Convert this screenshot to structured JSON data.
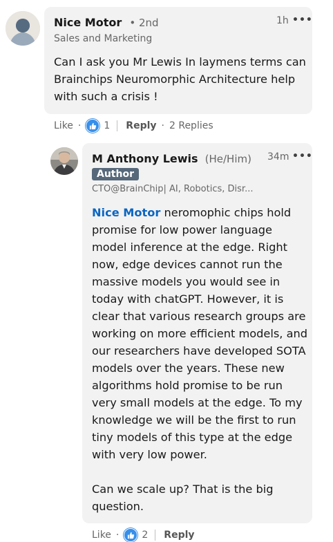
{
  "comment": {
    "author_name": "Nice Motor",
    "degree": "• 2nd",
    "headline": "Sales and Marketing",
    "time": "1h",
    "more": "•••",
    "text": "Can I ask you Mr Lewis In laymens terms can\nBrainchips Neuromorphic Architecture help\nwith such a crisis !",
    "actions": {
      "like": "Like",
      "like_count": "1",
      "reply": "Reply",
      "replies": "2 Replies"
    }
  },
  "reply": {
    "author_name": "M Anthony Lewis",
    "pronouns": "(He/Him)",
    "badge": "Author",
    "headline": "CTO@BrainChip| AI, Robotics, Disr...",
    "time": "34m",
    "more": "•••",
    "mention": "Nice Motor",
    "text": " neromophic chips hold\npromise for low power language\nmodel inference at the edge. Right\nnow, edge devices cannot run the\nmassive models you would see in\ntoday with chatGPT. However, it is\nclear that various research groups are\nworking on more efficient models, and\nour researchers have developed SOTA\nmodels over the years. These new\nalgorithms hold promise to be run\nvery small models at the edge. To my\nknowledge we will be the first to run\ntiny models of this type at the edge\nwith very low power.\n\nCan we scale up? That is the big\nquestion.",
    "actions": {
      "like": "Like",
      "like_count": "2",
      "reply": "Reply"
    }
  },
  "colors": {
    "bubble": "#f2f2f2",
    "link": "#0a66c2",
    "like": "#378fe9",
    "badge": "#56687a"
  }
}
